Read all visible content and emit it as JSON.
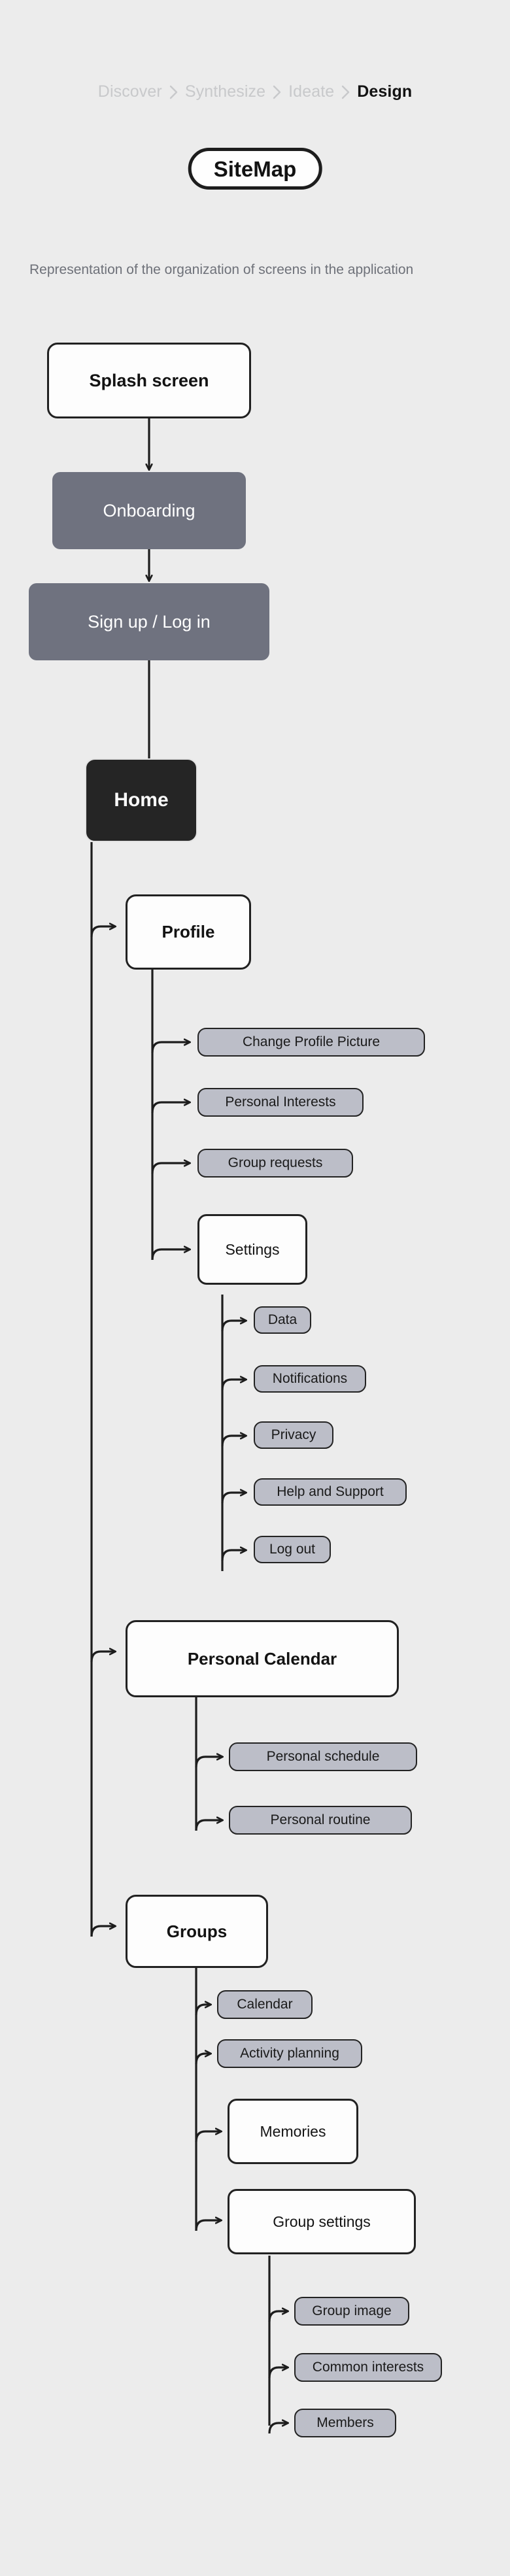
{
  "breadcrumb": {
    "items": [
      {
        "label": "Discover",
        "active": false
      },
      {
        "label": "Synthesize",
        "active": false
      },
      {
        "label": "Ideate",
        "active": false
      },
      {
        "label": "Design",
        "active": true
      }
    ],
    "separator_icon": "chevron-right-icon"
  },
  "title": "SiteMap",
  "description": "Representation of the organization of screens in the application",
  "colors": {
    "background": "#ececec",
    "stroke": "#212121",
    "white_node": "#fdfdfd",
    "slate_node": "#6f727f",
    "dark_node": "#252525",
    "pill_node": "#bcbec8",
    "crumb_inactive": "#c8c9cb",
    "crumb_active": "#121212",
    "description_text": "#6e7179"
  },
  "nodes": {
    "splash": "Splash screen",
    "onboarding": "Onboarding",
    "signup": "Sign up / Log in",
    "home": "Home",
    "profile": "Profile",
    "change_profile_picture": "Change Profile Picture",
    "personal_interests": "Personal Interests",
    "group_requests": "Group requests",
    "settings": "Settings",
    "data": "Data",
    "notifications": "Notifications",
    "privacy": "Privacy",
    "help_and_support": "Help and Support",
    "log_out": "Log out",
    "personal_calendar": "Personal Calendar",
    "personal_schedule": "Personal schedule",
    "personal_routine": "Personal routine",
    "groups": "Groups",
    "calendar": "Calendar",
    "activity_planning": "Activity planning",
    "memories": "Memories",
    "group_settings": "Group settings",
    "group_image": "Group image",
    "common_interests": "Common interests",
    "members": "Members"
  },
  "chart_data": {
    "type": "tree",
    "title": "SiteMap",
    "subtitle": "Representation of the organization of screens in the application",
    "root": "Splash screen",
    "edges": [
      {
        "from": "Splash screen",
        "to": "Onboarding",
        "style": "straight-arrow"
      },
      {
        "from": "Onboarding",
        "to": "Sign up / Log in",
        "style": "straight-arrow"
      },
      {
        "from": "Sign up / Log in",
        "to": "Home",
        "style": "straight-arrow"
      },
      {
        "from": "Home",
        "to": "Profile",
        "style": "elbow-arrow"
      },
      {
        "from": "Home",
        "to": "Personal Calendar",
        "style": "elbow-arrow"
      },
      {
        "from": "Home",
        "to": "Groups",
        "style": "elbow-arrow"
      },
      {
        "from": "Profile",
        "to": "Change Profile Picture",
        "style": "elbow-arrow"
      },
      {
        "from": "Profile",
        "to": "Personal Interests",
        "style": "elbow-arrow"
      },
      {
        "from": "Profile",
        "to": "Group requests",
        "style": "elbow-arrow"
      },
      {
        "from": "Profile",
        "to": "Settings",
        "style": "elbow-arrow"
      },
      {
        "from": "Settings",
        "to": "Data",
        "style": "elbow-arrow"
      },
      {
        "from": "Settings",
        "to": "Notifications",
        "style": "elbow-arrow"
      },
      {
        "from": "Settings",
        "to": "Privacy",
        "style": "elbow-arrow"
      },
      {
        "from": "Settings",
        "to": "Help and Support",
        "style": "elbow-arrow"
      },
      {
        "from": "Settings",
        "to": "Log out",
        "style": "elbow-arrow"
      },
      {
        "from": "Personal Calendar",
        "to": "Personal schedule",
        "style": "elbow-arrow"
      },
      {
        "from": "Personal Calendar",
        "to": "Personal routine",
        "style": "elbow-arrow"
      },
      {
        "from": "Groups",
        "to": "Calendar",
        "style": "elbow-arrow"
      },
      {
        "from": "Groups",
        "to": "Activity planning",
        "style": "elbow-arrow"
      },
      {
        "from": "Groups",
        "to": "Memories",
        "style": "elbow-arrow"
      },
      {
        "from": "Groups",
        "to": "Group settings",
        "style": "elbow-arrow"
      },
      {
        "from": "Group settings",
        "to": "Group image",
        "style": "elbow-arrow"
      },
      {
        "from": "Group settings",
        "to": "Common interests",
        "style": "elbow-arrow"
      },
      {
        "from": "Group settings",
        "to": "Members",
        "style": "elbow-arrow"
      }
    ],
    "levels": {
      "Splash screen": 0,
      "Onboarding": 0,
      "Sign up / Log in": 0,
      "Home": 0,
      "Profile": 1,
      "Personal Calendar": 1,
      "Groups": 1,
      "Change Profile Picture": 2,
      "Personal Interests": 2,
      "Group requests": 2,
      "Settings": 2,
      "Personal schedule": 2,
      "Personal routine": 2,
      "Calendar": 2,
      "Activity planning": 2,
      "Memories": 2,
      "Group settings": 2,
      "Data": 3,
      "Notifications": 3,
      "Privacy": 3,
      "Help and Support": 3,
      "Log out": 3,
      "Group image": 3,
      "Common interests": 3,
      "Members": 3
    }
  }
}
